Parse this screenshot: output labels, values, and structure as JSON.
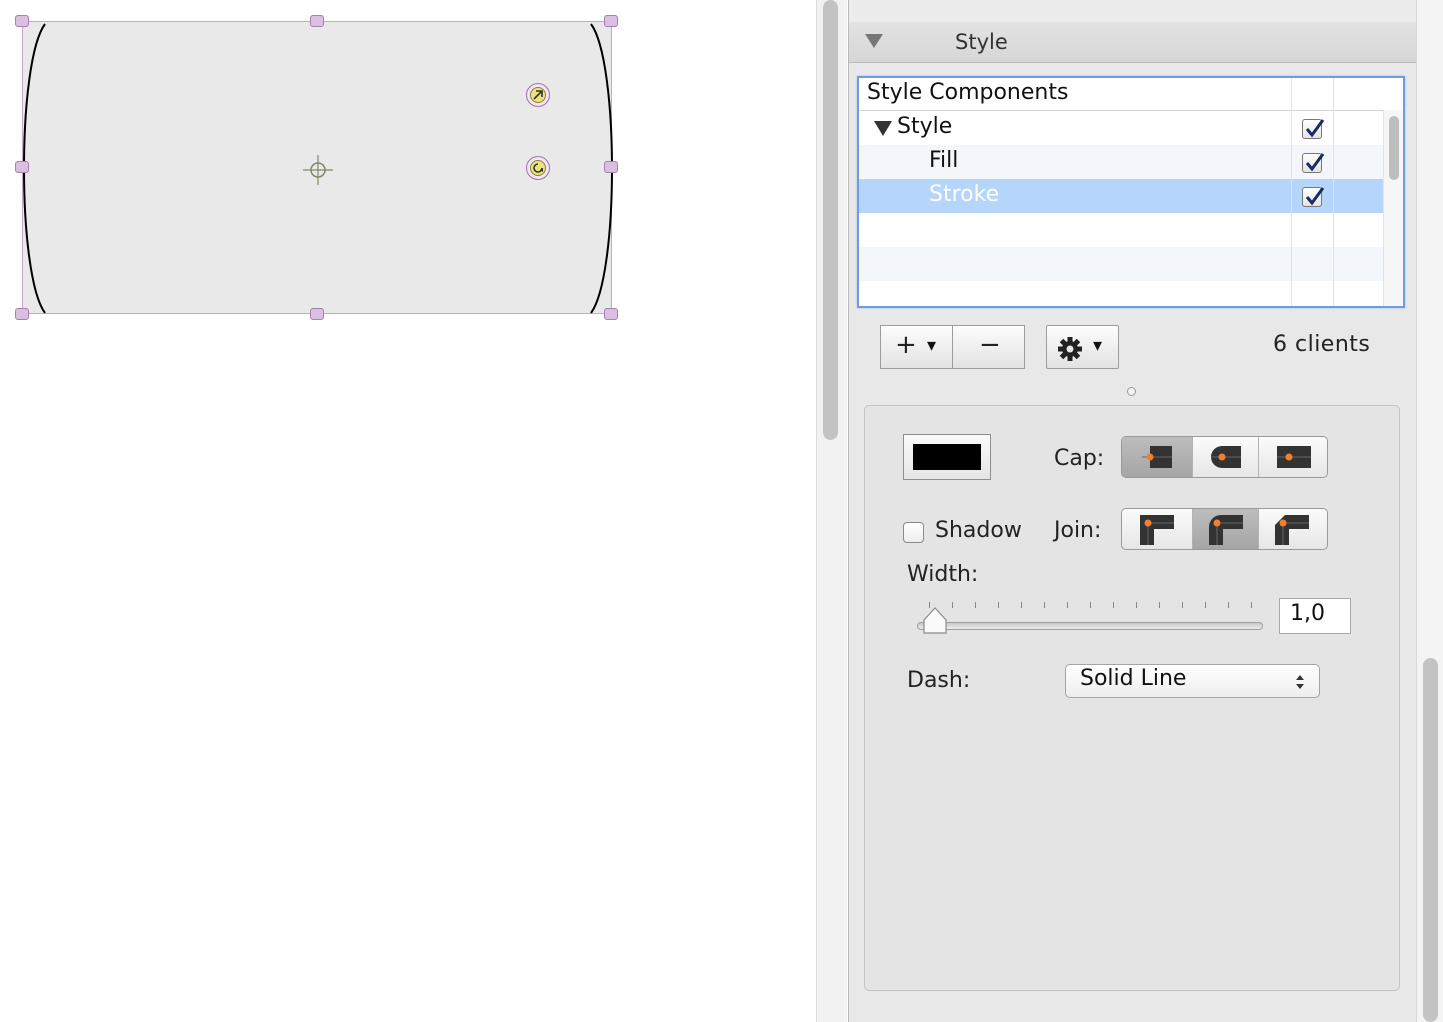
{
  "inspector": {
    "section_title": "Style",
    "table": {
      "header": "Style Components",
      "rows": [
        {
          "label": "Style",
          "checked": true
        },
        {
          "label": "Fill",
          "checked": true
        },
        {
          "label": "Stroke",
          "checked": true,
          "selected": true
        }
      ]
    },
    "buttons": {
      "add": "+",
      "remove": "−",
      "dropdown_caret": "▾"
    },
    "clients_text": "6  clients",
    "stroke": {
      "color": "#000000",
      "cap_label": "Cap:",
      "cap_selected_index": 0,
      "join_label": "Join:",
      "join_selected_index": 1,
      "shadow_label": "Shadow",
      "shadow_checked": false,
      "width_label": "Width:",
      "width_value": "1,0",
      "width_slider_fraction": 0.03,
      "dash_label": "Dash:",
      "dash_value": "Solid Line"
    }
  },
  "colors": {
    "selection": "#b5d5fb",
    "table_focus": "#6c9de2",
    "accent_orange": "#f08030"
  }
}
